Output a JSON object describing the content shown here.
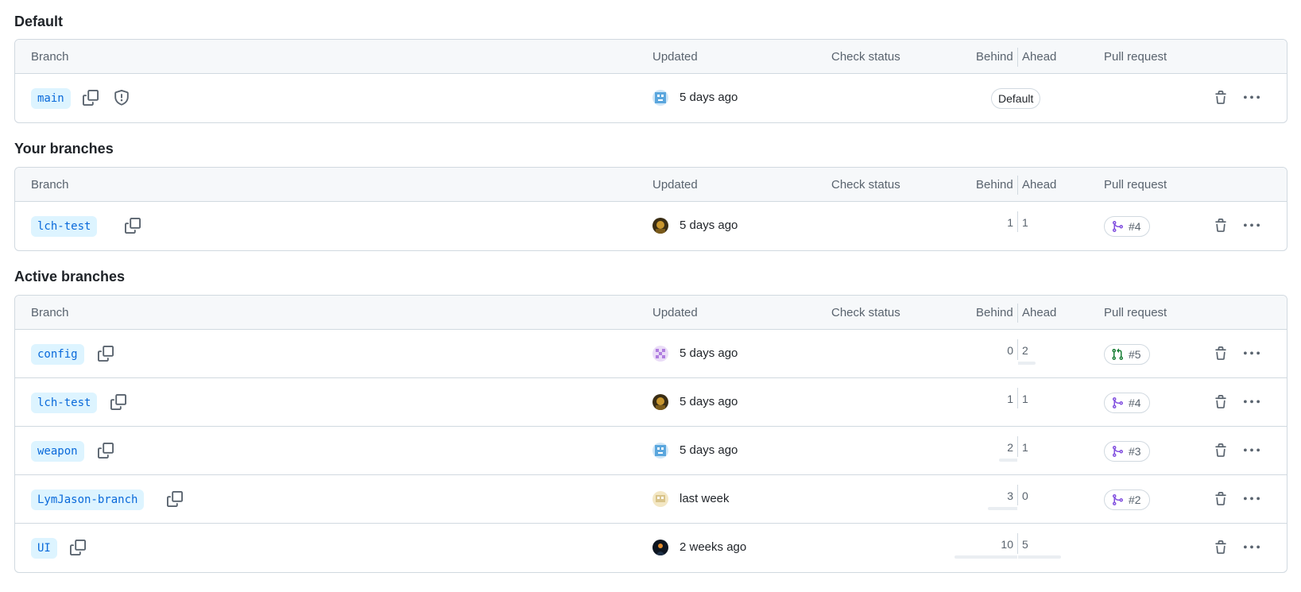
{
  "columns": {
    "branch": "Branch",
    "updated": "Updated",
    "check_status": "Check status",
    "behind": "Behind",
    "ahead": "Ahead",
    "pull_request": "Pull request"
  },
  "sections": [
    {
      "title": "Default",
      "rows": [
        {
          "branch": "main",
          "avatar": "blue-bot-avatar",
          "updated": "5 days ago",
          "default_label": "Default"
        }
      ]
    },
    {
      "title": "Your branches",
      "rows": [
        {
          "branch": "lch-test",
          "avatar": "dark-gold-avatar",
          "updated": "5 days ago",
          "behind": "1",
          "ahead": "1",
          "pr": "#4",
          "pr_state": "merged"
        }
      ]
    },
    {
      "title": "Active branches",
      "rows": [
        {
          "branch": "config",
          "avatar": "purple-pixel-avatar",
          "updated": "5 days ago",
          "behind": "0",
          "ahead": "2",
          "pr": "#5",
          "pr_state": "open"
        },
        {
          "branch": "lch-test",
          "avatar": "dark-gold-avatar",
          "updated": "5 days ago",
          "behind": "1",
          "ahead": "1",
          "pr": "#4",
          "pr_state": "merged"
        },
        {
          "branch": "weapon",
          "avatar": "blue-bot-avatar",
          "updated": "5 days ago",
          "behind": "2",
          "ahead": "1",
          "pr": "#3",
          "pr_state": "merged"
        },
        {
          "branch": "LymJason-branch",
          "avatar": "tan-pixel-avatar",
          "updated": "last week",
          "behind": "3",
          "ahead": "0",
          "pr": "#2",
          "pr_state": "merged"
        },
        {
          "branch": "UI",
          "avatar": "dark-space-avatar",
          "updated": "2 weeks ago",
          "behind": "10",
          "ahead": "5"
        }
      ]
    }
  ],
  "colors": {
    "branch_bg": "#ddf4ff",
    "branch_text": "#0969da",
    "merged": "#8250df",
    "open": "#1a7f37",
    "border": "#d1d9e0",
    "header_bg": "#f6f8fa"
  }
}
